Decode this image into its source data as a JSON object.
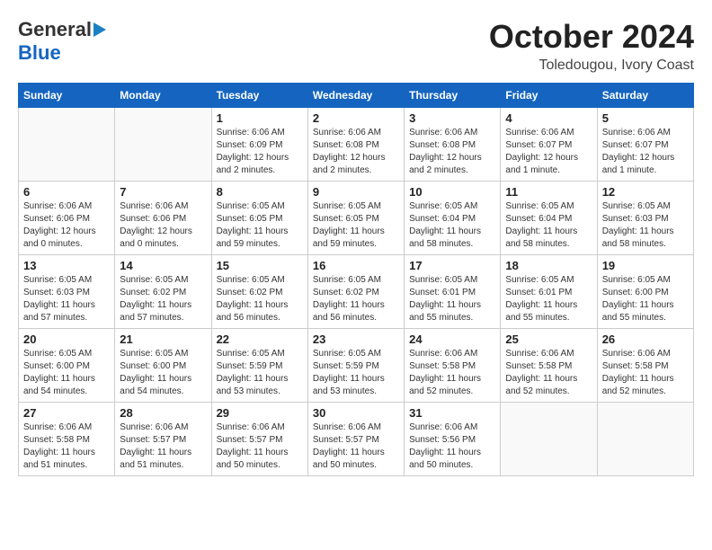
{
  "header": {
    "logo_general": "General",
    "logo_blue": "Blue",
    "month_title": "October 2024",
    "subtitle": "Toledougou, Ivory Coast"
  },
  "days_of_week": [
    "Sunday",
    "Monday",
    "Tuesday",
    "Wednesday",
    "Thursday",
    "Friday",
    "Saturday"
  ],
  "weeks": [
    [
      {
        "day": "",
        "info": ""
      },
      {
        "day": "",
        "info": ""
      },
      {
        "day": "1",
        "info": "Sunrise: 6:06 AM\nSunset: 6:09 PM\nDaylight: 12 hours\nand 2 minutes."
      },
      {
        "day": "2",
        "info": "Sunrise: 6:06 AM\nSunset: 6:08 PM\nDaylight: 12 hours\nand 2 minutes."
      },
      {
        "day": "3",
        "info": "Sunrise: 6:06 AM\nSunset: 6:08 PM\nDaylight: 12 hours\nand 2 minutes."
      },
      {
        "day": "4",
        "info": "Sunrise: 6:06 AM\nSunset: 6:07 PM\nDaylight: 12 hours\nand 1 minute."
      },
      {
        "day": "5",
        "info": "Sunrise: 6:06 AM\nSunset: 6:07 PM\nDaylight: 12 hours\nand 1 minute."
      }
    ],
    [
      {
        "day": "6",
        "info": "Sunrise: 6:06 AM\nSunset: 6:06 PM\nDaylight: 12 hours\nand 0 minutes."
      },
      {
        "day": "7",
        "info": "Sunrise: 6:06 AM\nSunset: 6:06 PM\nDaylight: 12 hours\nand 0 minutes."
      },
      {
        "day": "8",
        "info": "Sunrise: 6:05 AM\nSunset: 6:05 PM\nDaylight: 11 hours\nand 59 minutes."
      },
      {
        "day": "9",
        "info": "Sunrise: 6:05 AM\nSunset: 6:05 PM\nDaylight: 11 hours\nand 59 minutes."
      },
      {
        "day": "10",
        "info": "Sunrise: 6:05 AM\nSunset: 6:04 PM\nDaylight: 11 hours\nand 58 minutes."
      },
      {
        "day": "11",
        "info": "Sunrise: 6:05 AM\nSunset: 6:04 PM\nDaylight: 11 hours\nand 58 minutes."
      },
      {
        "day": "12",
        "info": "Sunrise: 6:05 AM\nSunset: 6:03 PM\nDaylight: 11 hours\nand 58 minutes."
      }
    ],
    [
      {
        "day": "13",
        "info": "Sunrise: 6:05 AM\nSunset: 6:03 PM\nDaylight: 11 hours\nand 57 minutes."
      },
      {
        "day": "14",
        "info": "Sunrise: 6:05 AM\nSunset: 6:02 PM\nDaylight: 11 hours\nand 57 minutes."
      },
      {
        "day": "15",
        "info": "Sunrise: 6:05 AM\nSunset: 6:02 PM\nDaylight: 11 hours\nand 56 minutes."
      },
      {
        "day": "16",
        "info": "Sunrise: 6:05 AM\nSunset: 6:02 PM\nDaylight: 11 hours\nand 56 minutes."
      },
      {
        "day": "17",
        "info": "Sunrise: 6:05 AM\nSunset: 6:01 PM\nDaylight: 11 hours\nand 55 minutes."
      },
      {
        "day": "18",
        "info": "Sunrise: 6:05 AM\nSunset: 6:01 PM\nDaylight: 11 hours\nand 55 minutes."
      },
      {
        "day": "19",
        "info": "Sunrise: 6:05 AM\nSunset: 6:00 PM\nDaylight: 11 hours\nand 55 minutes."
      }
    ],
    [
      {
        "day": "20",
        "info": "Sunrise: 6:05 AM\nSunset: 6:00 PM\nDaylight: 11 hours\nand 54 minutes."
      },
      {
        "day": "21",
        "info": "Sunrise: 6:05 AM\nSunset: 6:00 PM\nDaylight: 11 hours\nand 54 minutes."
      },
      {
        "day": "22",
        "info": "Sunrise: 6:05 AM\nSunset: 5:59 PM\nDaylight: 11 hours\nand 53 minutes."
      },
      {
        "day": "23",
        "info": "Sunrise: 6:05 AM\nSunset: 5:59 PM\nDaylight: 11 hours\nand 53 minutes."
      },
      {
        "day": "24",
        "info": "Sunrise: 6:06 AM\nSunset: 5:58 PM\nDaylight: 11 hours\nand 52 minutes."
      },
      {
        "day": "25",
        "info": "Sunrise: 6:06 AM\nSunset: 5:58 PM\nDaylight: 11 hours\nand 52 minutes."
      },
      {
        "day": "26",
        "info": "Sunrise: 6:06 AM\nSunset: 5:58 PM\nDaylight: 11 hours\nand 52 minutes."
      }
    ],
    [
      {
        "day": "27",
        "info": "Sunrise: 6:06 AM\nSunset: 5:58 PM\nDaylight: 11 hours\nand 51 minutes."
      },
      {
        "day": "28",
        "info": "Sunrise: 6:06 AM\nSunset: 5:57 PM\nDaylight: 11 hours\nand 51 minutes."
      },
      {
        "day": "29",
        "info": "Sunrise: 6:06 AM\nSunset: 5:57 PM\nDaylight: 11 hours\nand 50 minutes."
      },
      {
        "day": "30",
        "info": "Sunrise: 6:06 AM\nSunset: 5:57 PM\nDaylight: 11 hours\nand 50 minutes."
      },
      {
        "day": "31",
        "info": "Sunrise: 6:06 AM\nSunset: 5:56 PM\nDaylight: 11 hours\nand 50 minutes."
      },
      {
        "day": "",
        "info": ""
      },
      {
        "day": "",
        "info": ""
      }
    ]
  ]
}
